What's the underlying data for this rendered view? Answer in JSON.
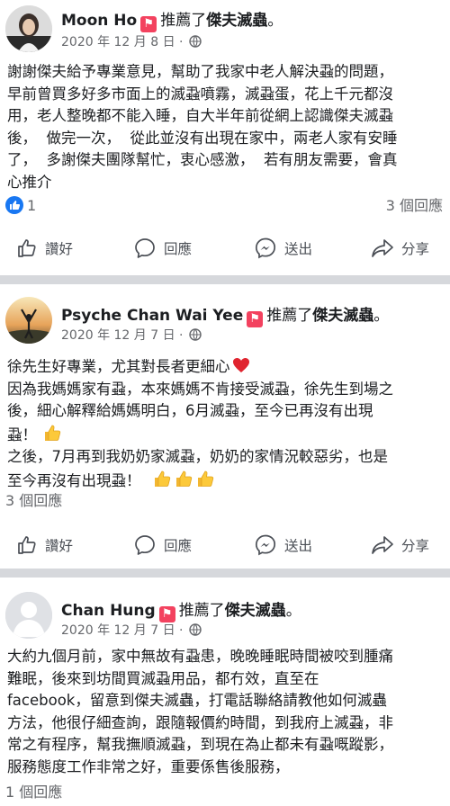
{
  "posts": [
    {
      "author": "Moon Ho",
      "recommends_text": "推薦了",
      "page_name": "傑夫滅蟲",
      "date": "2020 年 12 月 8 日 ·",
      "body": "謝謝傑夫給予專業意見，幫助了我家中老人解決蝨的問題，\n早前曾買多好多市面上的滅蝨噴霧，滅蝨蛋，花上千元都沒\n用，老人整晚都不能入睡，自大半年前從網上認識傑夫滅蝨\n後，  做完一次，  從此並沒有出現在家中，兩老人家有安睡\n了，  多謝傑夫團隊幫忙，衷心感激，  若有朋友需要，會真\n心推介",
      "likes": "1",
      "comments": "3 個回應"
    },
    {
      "author": "Psyche Chan Wai Yee",
      "recommends_text": "推薦了",
      "page_name": "傑夫滅蟲",
      "date": "2020 年 12 月 7 日 ·",
      "body_line1": "徐先生好專業，尤其對長者更細心",
      "body_line2": "因為我媽媽家有蝨，本來媽媽不肯接受滅蝨，徐先生到場之\n後，細心解釋給媽媽明白，6月滅蝨，至今已再沒有出現\n蝨！",
      "body_line3": "之後，7月再到我奶奶家滅蝨，奶奶的家情況較惡劣，也是\n至今再沒有出現蝨！",
      "comments": "3 個回應"
    },
    {
      "author": "Chan Hung",
      "recommends_text": "推薦了",
      "page_name": "傑夫滅蟲",
      "date": "2020 年 12 月 7 日 ·",
      "body": "大約九個月前，家中無故有蝨患，晚晚睡眠時間被咬到腫痛\n難眠，後來到坊間買滅蝨用品，都冇效，直至在\nfacebook，留意到傑夫滅蟲，打電話聯絡請教他如何滅蟲\n方法，他很仔細查詢，跟隨報價約時間，到我府上滅蝨，非\n常之有程序，幫我撫順滅蝨，到現在為止都未有蝨嘅蹤影，\n服務態度工作非常之好，重要係售後服務，",
      "comments": "1 個回應"
    }
  ],
  "actions": {
    "like": "讚好",
    "comment": "回應",
    "share_send": "送出",
    "share": "分享"
  },
  "colors": {
    "accent": "#1877f2",
    "badge": "#f3425f",
    "separator": "#d6d8dc",
    "muted": "#65676b"
  }
}
